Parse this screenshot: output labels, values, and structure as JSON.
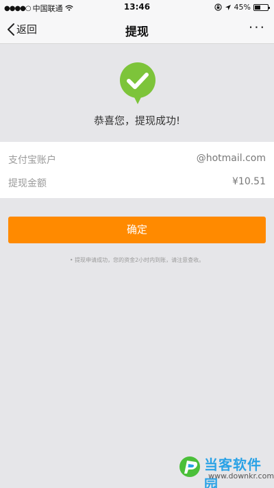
{
  "status_bar": {
    "signal": "●●●●○",
    "carrier": "中国联通",
    "time": "13:46",
    "battery_text": "45%",
    "battery_level": 0.45
  },
  "nav": {
    "back_label": "返回",
    "title": "提现",
    "more_label": "···"
  },
  "success": {
    "message": "恭喜您，提现成功!",
    "icon_color": "#7dc43a"
  },
  "info": {
    "rows": [
      {
        "label": "支付宝账户",
        "value": "@hotmail.com"
      },
      {
        "label": "提现金额",
        "value": "¥10.51"
      }
    ]
  },
  "confirm_button": {
    "label": "确定",
    "color": "#ff8a00"
  },
  "hint": "• 提现申请成功，您的资金2小时内到账，请注意查收。",
  "watermark": {
    "title": "当客软件园",
    "url": "www.downkr.com"
  }
}
